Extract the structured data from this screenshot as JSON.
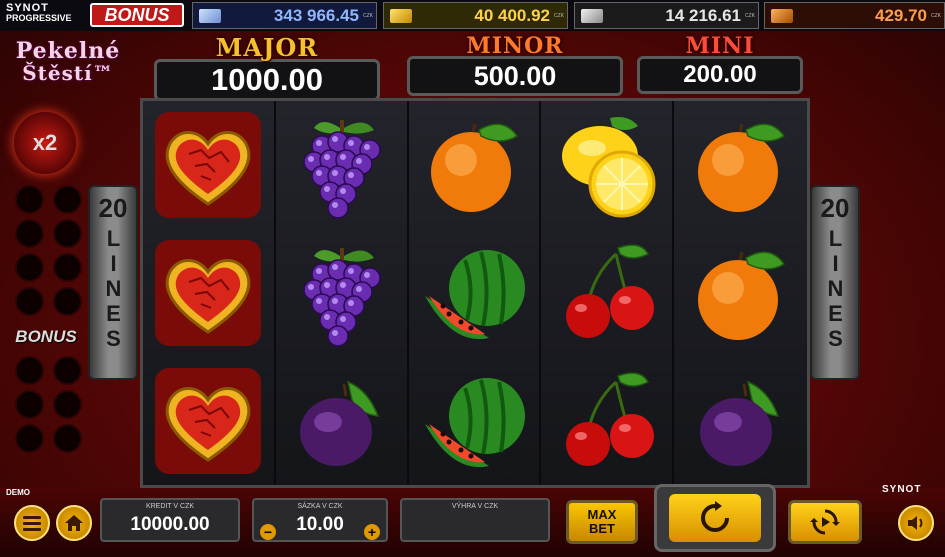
{
  "progressive": {
    "brand_line1": "SYNOT",
    "brand_line2": "PROGRESSIVE",
    "bonus_badge": "BONUS",
    "jackpots": [
      {
        "icon": "diamond-icon",
        "value": "343 966.45",
        "currency": "CZK"
      },
      {
        "icon": "gold-bar-icon",
        "value": "40 400.92",
        "currency": "CZK"
      },
      {
        "icon": "silver-bar-icon",
        "value": "14 216.61",
        "currency": "CZK"
      },
      {
        "icon": "bronze-bar-icon",
        "value": "429.70",
        "currency": "CZK"
      }
    ]
  },
  "logo": {
    "line1": "Pekelné",
    "line2": "Štěstí™"
  },
  "multiplier": "x2",
  "bonus_label": "BONUS",
  "lines": {
    "count": "20",
    "word": "LINES"
  },
  "jackpot_frames": {
    "major": {
      "title": "MAJOR",
      "value": "1000.00"
    },
    "minor": {
      "title": "MINOR",
      "value": "500.00"
    },
    "mini": {
      "title": "MINI",
      "value": "200.00"
    }
  },
  "reels": [
    [
      "heart",
      "heart",
      "heart"
    ],
    [
      "grapes",
      "grapes",
      "plum"
    ],
    [
      "orange",
      "watermelon",
      "watermelon"
    ],
    [
      "lemon",
      "cherries",
      "cherries"
    ],
    [
      "orange",
      "orange",
      "plum"
    ]
  ],
  "bottom": {
    "demo_label": "DEMO",
    "brand": "SYNOT",
    "credit_label": "KREDIT V CZK",
    "credit_value": "10000.00",
    "bet_label": "SÁZKA V CZK",
    "bet_value": "10.00",
    "bet_minus": "−",
    "bet_plus": "+",
    "win_label": "VÝHRA V CZK",
    "win_value": "",
    "maxbet_line1": "MAX",
    "maxbet_line2": "BET"
  },
  "colors": {
    "accent": "#f5b400",
    "major": "#f6c02b",
    "minor": "#ff7a2a",
    "mini": "#ff4b3a"
  }
}
